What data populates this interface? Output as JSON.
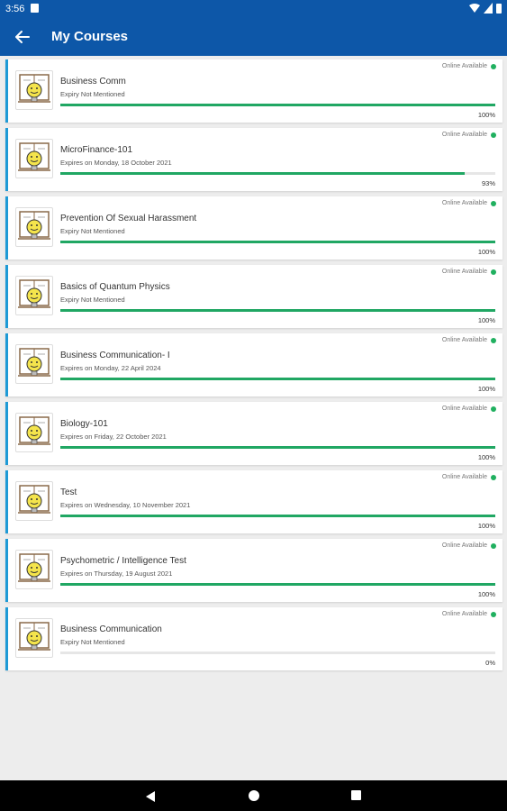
{
  "status_bar": {
    "time": "3:56"
  },
  "header": {
    "title": "My Courses",
    "back_icon": "arrow-left-icon"
  },
  "courses": [
    {
      "title": "Business Comm",
      "expiry": "Expiry Not Mentioned",
      "progress_label": "100%",
      "progress": 1.0,
      "online": "Online Available"
    },
    {
      "title": "MicroFinance-101",
      "expiry": "Expires on Monday, 18 October 2021",
      "progress_label": "93%",
      "progress": 0.93,
      "online": "Online Available"
    },
    {
      "title": "Prevention Of Sexual Harassment",
      "expiry": "Expiry Not Mentioned",
      "progress_label": "100%",
      "progress": 1.0,
      "online": "Online Available"
    },
    {
      "title": "Basics of Quantum Physics",
      "expiry": "Expiry Not Mentioned",
      "progress_label": "100%",
      "progress": 1.0,
      "online": "Online Available"
    },
    {
      "title": "Business Communication- I",
      "expiry": "Expires on Monday, 22 April 2024",
      "progress_label": "100%",
      "progress": 1.0,
      "online": "Online Available"
    },
    {
      "title": "Biology-101",
      "expiry": "Expires on Friday, 22 October 2021",
      "progress_label": "100%",
      "progress": 1.0,
      "online": "Online Available"
    },
    {
      "title": "Test",
      "expiry": "Expires on Wednesday, 10 November 2021",
      "progress_label": "100%",
      "progress": 1.0,
      "online": "Online Available"
    },
    {
      "title": "Psychometric / Intelligence Test",
      "expiry": "Expires on Thursday, 19 August 2021",
      "progress_label": "100%",
      "progress": 1.0,
      "online": "Online Available"
    },
    {
      "title": "Business Communication",
      "expiry": "Expiry Not Mentioned",
      "progress_label": "0%",
      "progress": 0.0,
      "online": "Online Available"
    }
  ],
  "colors": {
    "app_bar": "#0d57a8",
    "card_accent": "#1e9ad6",
    "progress": "#20a763",
    "online_dot": "#20b05f"
  },
  "nav_bar": {
    "icons": [
      "back-triangle-icon",
      "home-circle-icon",
      "recents-square-icon"
    ]
  }
}
